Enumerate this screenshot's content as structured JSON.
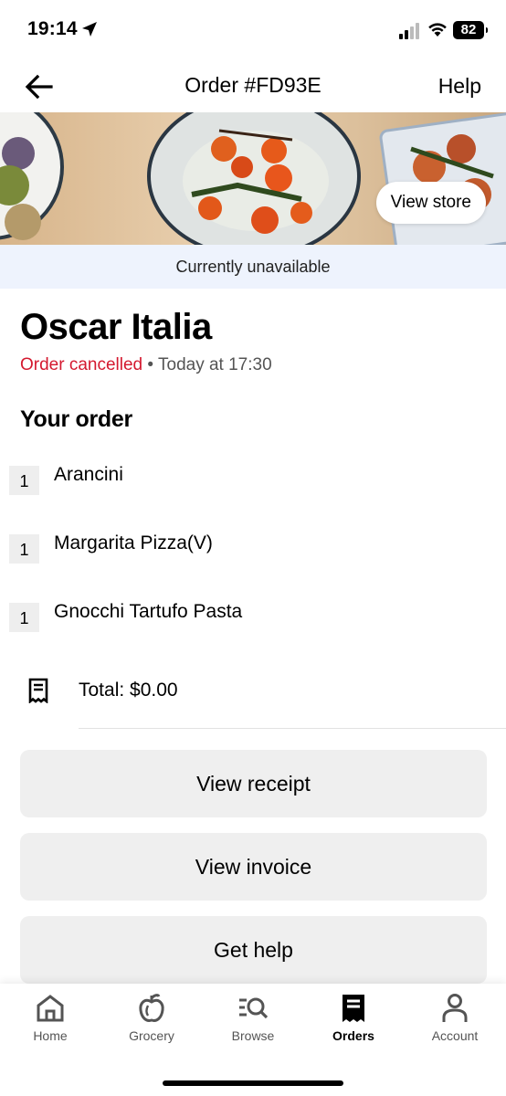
{
  "status_bar": {
    "time": "19:14",
    "battery": "82"
  },
  "header": {
    "title": "Order #FD93E",
    "help_label": "Help"
  },
  "hero": {
    "view_store_label": "View store"
  },
  "availability": "Currently unavailable",
  "store": {
    "name": "Oscar Italia",
    "status": "Order cancelled",
    "separator": " • ",
    "time": "Today at 17:30"
  },
  "order": {
    "heading": "Your order",
    "items": [
      {
        "qty": "1",
        "name": "Arancini"
      },
      {
        "qty": "1",
        "name": "Margarita Pizza(V)"
      },
      {
        "qty": "1",
        "name": "Gnocchi Tartufo Pasta"
      }
    ],
    "total": "Total: $0.00"
  },
  "actions": {
    "view_receipt": "View receipt",
    "view_invoice": "View invoice",
    "get_help": "Get help"
  },
  "tabs": [
    {
      "label": "Home",
      "icon": "home-icon"
    },
    {
      "label": "Grocery",
      "icon": "apple-icon"
    },
    {
      "label": "Browse",
      "icon": "browse-icon"
    },
    {
      "label": "Orders",
      "icon": "receipt-icon"
    },
    {
      "label": "Account",
      "icon": "person-icon"
    }
  ],
  "active_tab": "Orders",
  "colors": {
    "cancelled": "#d4192f",
    "unavailable_bg": "#eef3fd",
    "button_bg": "#efefef"
  }
}
